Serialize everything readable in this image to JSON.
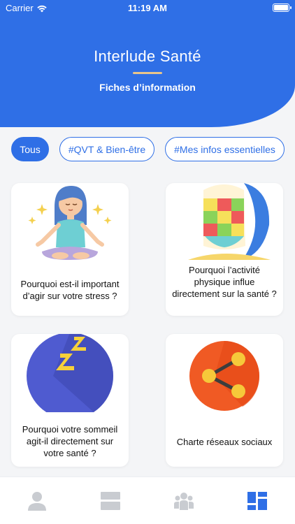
{
  "status_bar": {
    "carrier": "Carrier",
    "time": "11:19 AM"
  },
  "header": {
    "title": "Interlude Santé",
    "subtitle": "Fiches d’information"
  },
  "filters": [
    {
      "label": "Tous",
      "active": true
    },
    {
      "label": "#QVT & Bien-être",
      "active": false
    },
    {
      "label": "#Mes infos essentielles",
      "active": false
    }
  ],
  "cards": [
    {
      "title": "Pourquoi est-il important d’agir sur votre stress ?",
      "icon": "meditation-icon"
    },
    {
      "title": "Pourquoi l’activité physique influe directement sur la santé ?",
      "icon": "surfboard-icon"
    },
    {
      "title": "Pourquoi votre sommeil agit-il directement sur votre santé ?",
      "icon": "sleep-moon-icon"
    },
    {
      "title": "Charte réseaux sociaux",
      "icon": "share-icon"
    }
  ],
  "tabbar": {
    "tabs": [
      {
        "icon": "profile-icon",
        "active": false
      },
      {
        "icon": "list-icon",
        "active": false
      },
      {
        "icon": "group-icon",
        "active": false
      },
      {
        "icon": "dashboard-icon",
        "active": true
      }
    ]
  },
  "colors": {
    "primary": "#2f6fe6",
    "inactive_tab": "#c9ccd1",
    "accent_underline": "#e8c58a"
  }
}
